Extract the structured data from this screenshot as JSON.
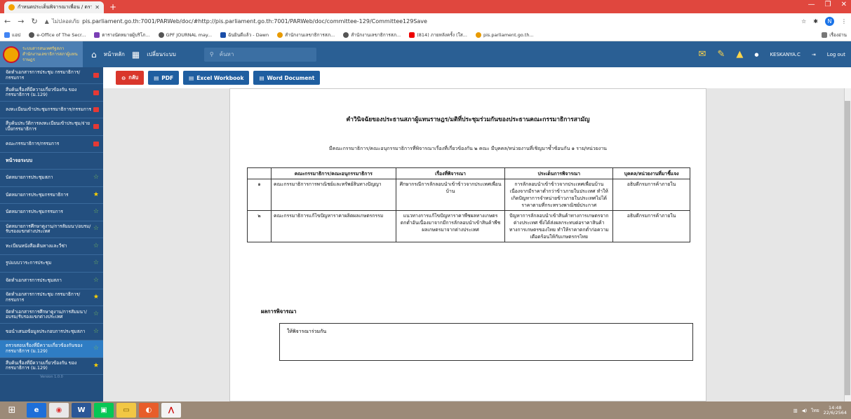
{
  "browser": {
    "tab_title": "กำหนดประเด็นพิจารณาเพื่อน / ตรวจ",
    "url": "pis.parliament.go.th:7001/PARWeb/doc/#http://pis.parliament.go.th:7001/PARWeb/doc/committee-129/Committee129Save",
    "insecure_label": "ไม่ปลอดภัย",
    "profile_initial": "N",
    "bookmarks": [
      "แอป",
      "e-Office of The Secr...",
      "ตารางนัดหมายผู้บริโภ...",
      "GPF JOURNAL may...",
      "ฉันยินดีแล้ว - Dawn",
      "สำนักงานเลขาธิการสภ...",
      "สำนักงานเลขาธิการสภ...",
      "(814) ภายหลังครั้ง (ใส...",
      "pis.parliament.go.th..."
    ],
    "bookmarks_right": "เรื่องอ่าน"
  },
  "app": {
    "logo_line1": "ระบบสารสนเทศรัฐสภา",
    "logo_line2": "สำนักงานเลขาธิการสภาผู้แทนราษฎร",
    "nav_home": "หน้าหลัก",
    "nav_change": "เปลี่ยนระบบ",
    "search_placeholder": "ค้นหา",
    "user": "KESKANYA.C",
    "logout": "Log out"
  },
  "sidebar": {
    "items": [
      {
        "label": "จัดทำเอกสารการประชุม กรรมาธิการ/กรรมการ",
        "marker": "red"
      },
      {
        "label": "สืบค้นเรื่องที่มีความเกี่ยวข้องกัน ของกรรมาธิการ (ม.129)",
        "marker": "red"
      },
      {
        "label": "ลงทะเบียนเข้าประชุมกรรมาธิการ/กรรมการ",
        "marker": "red"
      },
      {
        "label": "สืบค้นประวัติการลงทะเบียนเข้าประชุม/จ่ายเบี้ยกรรมาธิการ",
        "marker": "red"
      },
      {
        "label": "คณะกรรมาธิการ/กรรมการ",
        "marker": "red"
      },
      {
        "label": "หน้าจอระบบ",
        "marker": "head"
      },
      {
        "label": "นัดหมายการประชุมสภา",
        "marker": "star"
      },
      {
        "label": "นัดหมายการประชุมกรรมาธิการ",
        "marker": "gold"
      },
      {
        "label": "นัดหมายการประชุมกรรมการ",
        "marker": "star"
      },
      {
        "label": "นัดหมายการศึกษาดูงาน/การสัมมนา/อบรม/รับรองแขกต่างประเทศ",
        "marker": "star"
      },
      {
        "label": "ทะเบียนหนังสือเดินทางและวีซ่า",
        "marker": "star"
      },
      {
        "label": "รูปแบบวาระการประชุม",
        "marker": "star"
      },
      {
        "label": "จัดทำเอกสารการประชุมสภา",
        "marker": "star"
      },
      {
        "label": "จัดทำเอกสารการประชุม กรรมาธิการ/กรรมการ",
        "marker": "gold"
      },
      {
        "label": "จัดทำเอกสารการศึกษาดูงาน/การสัมมนา/อบรม/รับรองแขกต่างประเทศ",
        "marker": "star"
      },
      {
        "label": "ขอนำเสนอข้อมูลประกอบการประชุมสภา",
        "marker": "star"
      },
      {
        "label": "ตรวจสอบเรื่องที่มีความเกี่ยวข้องกันของกรรมาธิการ (ม.129)",
        "marker": "star",
        "active": true
      },
      {
        "label": "สืบค้นเรื่องที่มีความเกี่ยวข้องกัน ของกรรมาธิการ (ม.129)",
        "marker": "gold"
      }
    ],
    "version": "Version 1.0.0"
  },
  "toolbar": {
    "back": "กลับ",
    "pdf": "PDF",
    "excel": "Excel Workbook",
    "word": "Word Document"
  },
  "document": {
    "title": "คำวินิจฉัยของประธานสภาผู้แทนราษฎร/มติที่ประชุมร่วมกันของประธานคณะกรรมาธิการสามัญ",
    "subtitle": "มีคณะกรรมาธิการ/คณะอนุกรรมาธิการที่พิจารณาเรื่องที่เกี่ยวข้องกัน ๒ คณะ มีบุคคล/หน่วยงานที่เชิญมาซ้ำซ้อนกัน ๑ ราย/หน่วยงาน",
    "headers": [
      "",
      "คณะกรรมาธิการ/คณะอนุกรรมาธิการ",
      "เรื่องที่พิจารณา",
      "ประเด็นการพิจารณา",
      "บุคคล/หน่วยงานที่มาชี้แจง"
    ],
    "rows": [
      {
        "no": "๑",
        "committee": "คณะกรรมาธิการการพาณิชย์และทรัพย์สินทางปัญญา",
        "subject": "ศึกษากรณีการลักลอบนำเข้าข้าวจากประเทศเพื่อนบ้าน",
        "issue": "การลักลอบนำเข้าข้าวจากประเทศเพื่อนบ้านเนื่องจากมีราคาต่ำกว่าข้าวภายในประเทศ ทำให้เกิดปัญหาการจำหน่ายข้าวภายในประเทศไม่ได้ราคาตามที่กระทรวงพาณิชย์ประกาศ",
        "agency": "อธิบดีกรมการค้าภายใน"
      },
      {
        "no": "๒",
        "committee": "คณะกรรมาธิการแก้ไขปัญหาราคาผลิตผลเกษตรกรรม",
        "subject": "แนวทางการแก้ไขปัญหาราคาพืชผลทางเกษตรตกต่ำอันเนื่องมาจากมีการลักลอบนำเข้าสินค้าพืชผลเกษตรมาจากต่างประเทศ",
        "issue": "ปัญหาการลักลอบนำเข้าสินค้าทางการเกษตรจากต่างประเทศ ซึ่งได้ส่งผลกระทบต่อราคาสินค้าทางการเกษตรของไทย ทำให้ราคาตกต่ำก่อความเดือดร้อนให้กับเกษตรกรไทย",
        "agency": "อธิบดีกรมการค้าภายใน"
      }
    ],
    "result_label": "ผลการพิจารณา",
    "result_text": "ให้พิจารณาร่วมกัน"
  },
  "taskbar": {
    "lang": "ไทย",
    "time": "14:48",
    "date": "22/6/2564"
  }
}
